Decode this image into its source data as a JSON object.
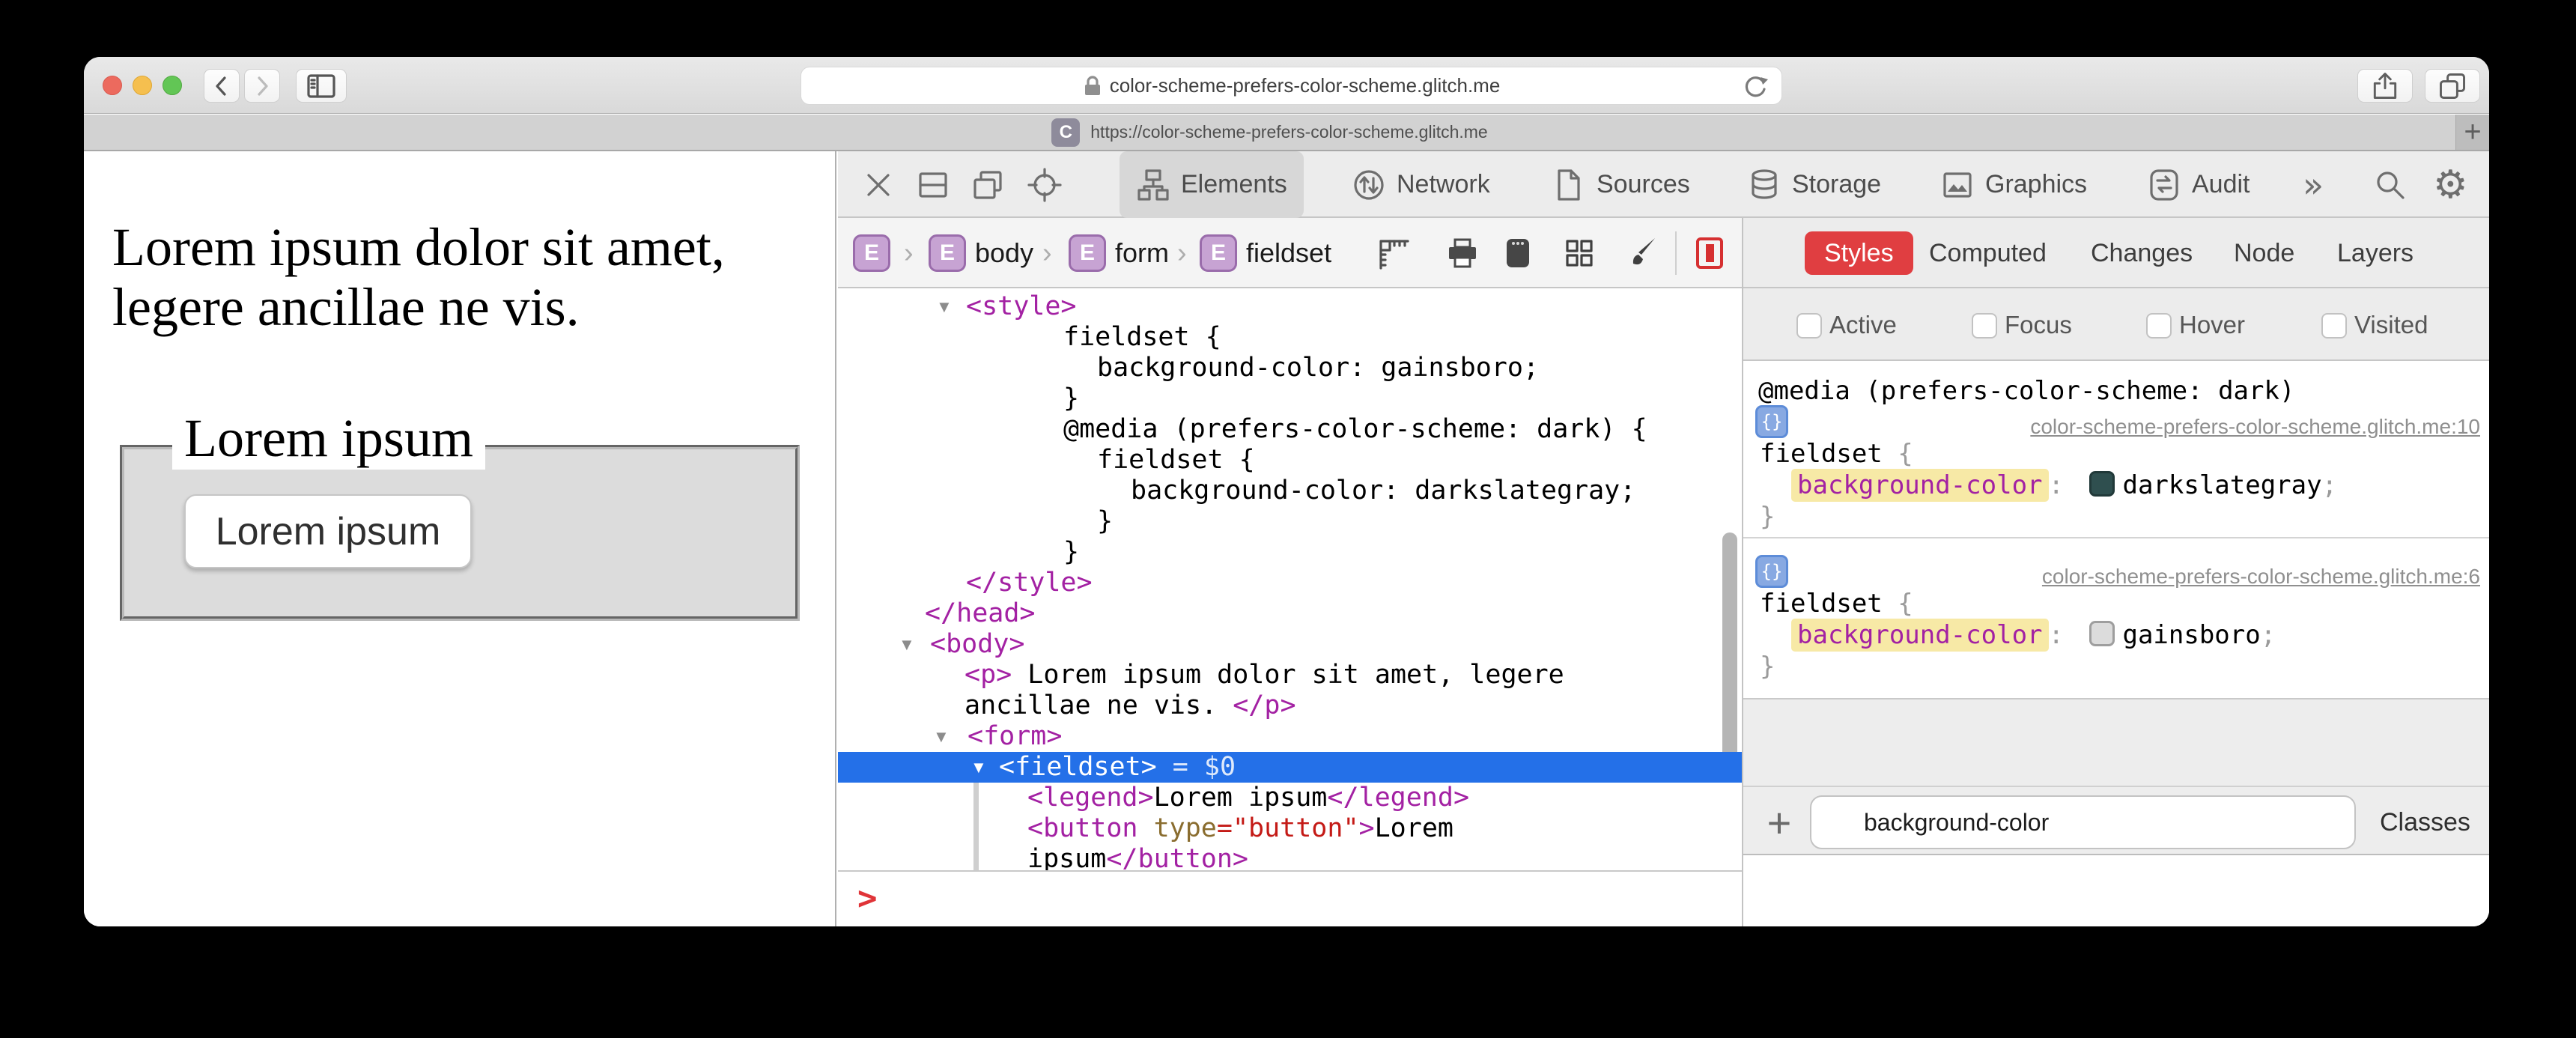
{
  "browser": {
    "window_controls": [
      "close",
      "minimize",
      "zoom"
    ],
    "url": "color-scheme-prefers-color-scheme.glitch.me",
    "tab_title": "https://color-scheme-prefers-color-scheme.glitch.me",
    "tab_favicon_letter": "C",
    "new_tab_label": "+",
    "icons": [
      "back-icon",
      "forward-icon",
      "sidebar-icon",
      "lock-icon",
      "reload-icon",
      "share-icon",
      "tab-overview-icon"
    ]
  },
  "page": {
    "paragraph_line1": "Lorem ipsum dolor sit amet,",
    "paragraph_line2": "legere ancillae ne vis.",
    "legend": "Lorem ipsum",
    "button_label": "Lorem ipsum"
  },
  "devtools": {
    "toolbar": {
      "left_icons": [
        "close-icon",
        "dock-icon",
        "detach-icon",
        "inspect-target-icon"
      ],
      "tabs": [
        {
          "label": "Elements",
          "icon": "elements-icon",
          "active": true
        },
        {
          "label": "Network",
          "icon": "network-icon",
          "active": false
        },
        {
          "label": "Sources",
          "icon": "sources-icon",
          "active": false
        },
        {
          "label": "Storage",
          "icon": "storage-icon",
          "active": false
        },
        {
          "label": "Graphics",
          "icon": "graphics-icon",
          "active": false
        },
        {
          "label": "Audit",
          "icon": "audit-icon",
          "active": false
        }
      ],
      "overflow_label": "»",
      "right_icons": [
        "search-icon",
        "gear-icon"
      ]
    },
    "breadcrumb": {
      "items": [
        {
          "badge": "E",
          "label": ""
        },
        {
          "badge": "E",
          "label": "body"
        },
        {
          "badge": "E",
          "label": "form"
        },
        {
          "badge": "E",
          "label": "fieldset"
        }
      ],
      "separator": "›",
      "action_icons": [
        "ruler-icon",
        "print-icon",
        "force-appearance-icon",
        "grid-overlay-icon",
        "paintbrush-icon",
        "element-selection-icon"
      ]
    },
    "tree": {
      "rows": [
        {
          "indent": 171,
          "tri": 131,
          "parts": [
            [
              "<style>",
              "tag"
            ]
          ]
        },
        {
          "indent": 301,
          "parts": [
            [
              "fieldset {",
              "plain"
            ]
          ]
        },
        {
          "indent": 346,
          "parts": [
            [
              "background-color: gainsboro;",
              "plain"
            ]
          ]
        },
        {
          "indent": 301,
          "parts": [
            [
              "}",
              "plain"
            ]
          ]
        },
        {
          "indent": 301,
          "parts": [
            [
              "@media (prefers-color-scheme: dark) {",
              "plain"
            ]
          ]
        },
        {
          "indent": 346,
          "parts": [
            [
              "fieldset {",
              "plain"
            ]
          ]
        },
        {
          "indent": 391,
          "parts": [
            [
              "background-color: darkslategray;",
              "plain"
            ]
          ]
        },
        {
          "indent": 346,
          "parts": [
            [
              "}",
              "plain"
            ]
          ]
        },
        {
          "indent": 301,
          "parts": [
            [
              "}",
              "plain"
            ]
          ]
        },
        {
          "indent": 171,
          "parts": [
            [
              "</style>",
              "tag"
            ]
          ]
        },
        {
          "indent": 116,
          "parts": [
            [
              "</head>",
              "tag"
            ]
          ]
        },
        {
          "indent": 123,
          "tri": 81,
          "parts": [
            [
              "<body>",
              "tag"
            ]
          ]
        },
        {
          "indent": 169,
          "parts": [
            [
              "<p>",
              "tag"
            ],
            [
              " Lorem ipsum dolor sit amet, legere",
              "plain"
            ]
          ]
        },
        {
          "indent": 169,
          "parts": [
            [
              "ancillae ne vis. ",
              "plain"
            ],
            [
              "</p>",
              "tag"
            ]
          ]
        },
        {
          "indent": 173,
          "tri": 127,
          "parts": [
            [
              "<form>",
              "tag"
            ]
          ]
        },
        {
          "indent": 215,
          "tri": 177,
          "selected": true,
          "parts": [
            [
              "<fieldset>",
              "tag"
            ],
            [
              " = $0",
              "dim"
            ]
          ]
        },
        {
          "indent": 253,
          "parts": [
            [
              "<legend>",
              "tag"
            ],
            [
              "Lorem ipsum",
              "plain"
            ],
            [
              "</legend>",
              "tag"
            ]
          ]
        },
        {
          "indent": 253,
          "parts": [
            [
              "<button",
              "tag"
            ],
            [
              " type",
              "attr"
            ],
            [
              "=",
              "eq"
            ],
            [
              "\"button\"",
              "val"
            ],
            [
              ">",
              "tag"
            ],
            [
              "Lorem",
              "plain"
            ]
          ]
        },
        {
          "indent": 253,
          "parts": [
            [
              "ipsum",
              "plain"
            ],
            [
              "</button>",
              "tag"
            ]
          ]
        }
      ]
    },
    "console_prompt": ">",
    "styles_panel": {
      "tabs": [
        "Styles",
        "Computed",
        "Changes",
        "Node",
        "Layers"
      ],
      "active_tab": "Styles",
      "pseudo_checkboxes": [
        "Active",
        "Focus",
        "Hover",
        "Visited"
      ],
      "rules": [
        {
          "media": "@media (prefers-color-scheme: dark)",
          "source_link": "color-scheme-prefers-color-scheme.glitch.me:10",
          "selector": "fieldset",
          "open_brace": "{",
          "property": "background-color",
          "colon": ":",
          "value": "darkslategray",
          "semicolon": ";",
          "swatch": "#2F4F4F",
          "close_brace": "}"
        },
        {
          "source_link": "color-scheme-prefers-color-scheme.glitch.me:6",
          "selector": "fieldset",
          "open_brace": "{",
          "property": "background-color",
          "colon": ":",
          "value": "gainsboro",
          "semicolon": ";",
          "swatch": "#DCDCDC",
          "close_brace": "}"
        }
      ],
      "add_label": "+",
      "filter_value": "background-color",
      "classes_label": "Classes"
    }
  },
  "colors": {
    "traffic_red": "#EC6A5E",
    "traffic_yellow": "#F5BF4F",
    "traffic_green": "#62C655",
    "selection_blue": "#2470E8",
    "styles_tab_red": "#E03E41",
    "tag_magenta": "#A321A3",
    "attr_value_red": "#C41A16",
    "highlight_yellow": "#F7E9A6",
    "swatch_darkslategray": "#2F4F4F",
    "swatch_gainsboro": "#DCDCDC",
    "fieldset_background": "#DCDCDC",
    "console_prompt_red": "#E03438"
  }
}
